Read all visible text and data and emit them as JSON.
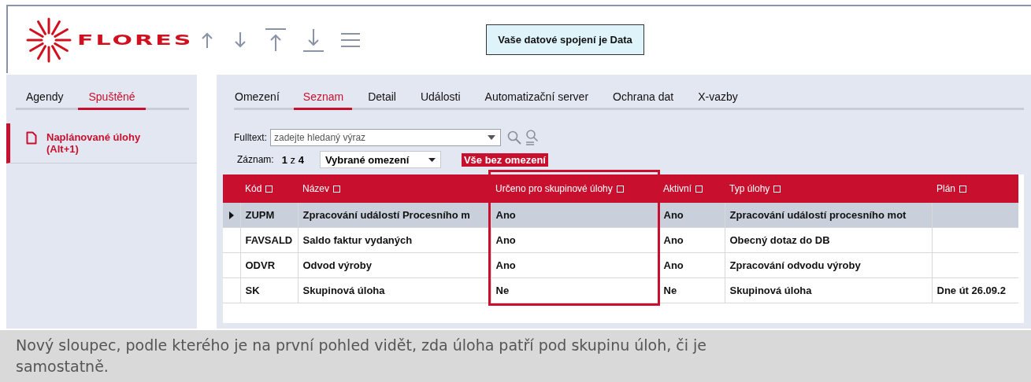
{
  "header": {
    "logo_text": "FLORES",
    "status": "Vaše datové spojení je Data"
  },
  "sidebar": {
    "tabs": [
      {
        "label": "Agendy",
        "selected": false
      },
      {
        "label": "Spuštěné",
        "selected": true
      }
    ],
    "items": [
      {
        "label": "Naplánované úlohy (Alt+1)",
        "selected": true
      }
    ]
  },
  "main": {
    "tabs": [
      {
        "label": "Omezení",
        "selected": false
      },
      {
        "label": "Seznam",
        "selected": true
      },
      {
        "label": "Detail",
        "selected": false
      },
      {
        "label": "Události",
        "selected": false
      },
      {
        "label": "Automatizační server",
        "selected": false
      },
      {
        "label": "Ochrana dat",
        "selected": false
      },
      {
        "label": "X-vazby",
        "selected": false
      }
    ],
    "fulltext": {
      "label": "Fulltext:",
      "placeholder": "zadejte hledaný výraz"
    },
    "record": {
      "label": "Záznam:",
      "value": "**1** z **4**"
    },
    "filter_select": {
      "value": "Vybrané omezení"
    },
    "filter_badge": "Vše bez omezení"
  },
  "table": {
    "columns": [
      {
        "label": "Kód",
        "highlighted": false
      },
      {
        "label": "Název",
        "highlighted": false
      },
      {
        "label": "Určeno pro skupinové úlohy",
        "highlighted": true
      },
      {
        "label": "Aktivní",
        "highlighted": false
      },
      {
        "label": "Typ úlohy",
        "highlighted": false
      },
      {
        "label": "Plán",
        "highlighted": false
      }
    ],
    "rows": [
      {
        "selected": true,
        "cells": [
          "ZUPM",
          "Zpracování událostí Procesního m",
          "Ano",
          "Ano",
          "Zpracování událostí procesního mot",
          ""
        ]
      },
      {
        "selected": false,
        "cells": [
          "FAVSALD",
          "Saldo faktur vydaných",
          "Ano",
          "Ano",
          "Obecný dotaz do DB",
          ""
        ]
      },
      {
        "selected": false,
        "cells": [
          "ODVR",
          "Odvod výroby",
          "Ano",
          "Ano",
          "Zpracování odvodu výroby",
          ""
        ]
      },
      {
        "selected": false,
        "cells": [
          "SK",
          "Skupinová úloha",
          "Ne",
          "Ne",
          "Skupinová úloha",
          "Dne út 26.09.2"
        ]
      }
    ]
  },
  "caption": "Nový sloupec, podle kterého je na první pohled vidět, zda úloha patří pod skupinu úloh, či je samostatně."
}
